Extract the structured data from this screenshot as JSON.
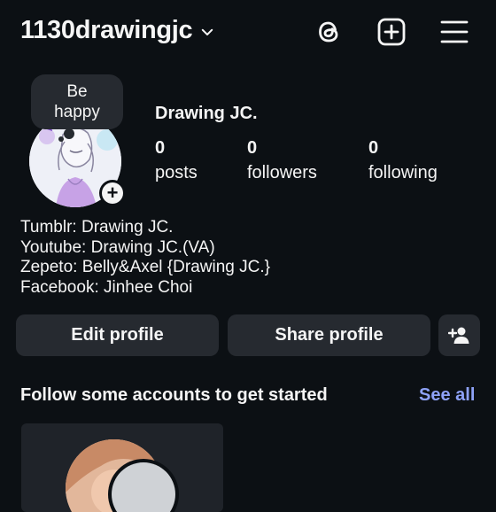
{
  "header": {
    "username": "1130drawingjc",
    "icons": [
      "chevron-down-icon",
      "threads-icon",
      "new-post-icon",
      "menu-icon"
    ]
  },
  "profile": {
    "note": [
      "Be",
      "happy"
    ],
    "display_name": "Drawing JC.",
    "stats": [
      {
        "num": "0",
        "label": "posts"
      },
      {
        "num": "0",
        "label": "followers"
      },
      {
        "num": "0",
        "label": "following"
      }
    ],
    "bio": [
      "Tumblr: Drawing JC.",
      "Youtube: Drawing JC.(VA)",
      "Zepeto: Belly&Axel {Drawing JC.}",
      "Facebook: Jinhee Choi"
    ]
  },
  "actions": {
    "edit": "Edit profile",
    "share": "Share profile"
  },
  "suggestions": {
    "title": "Follow some accounts to get started",
    "see_all": "See all"
  },
  "colors": {
    "background": "#0c1014",
    "button": "#262a30",
    "link": "#8ea2f7",
    "text": "#f5f5f5"
  }
}
